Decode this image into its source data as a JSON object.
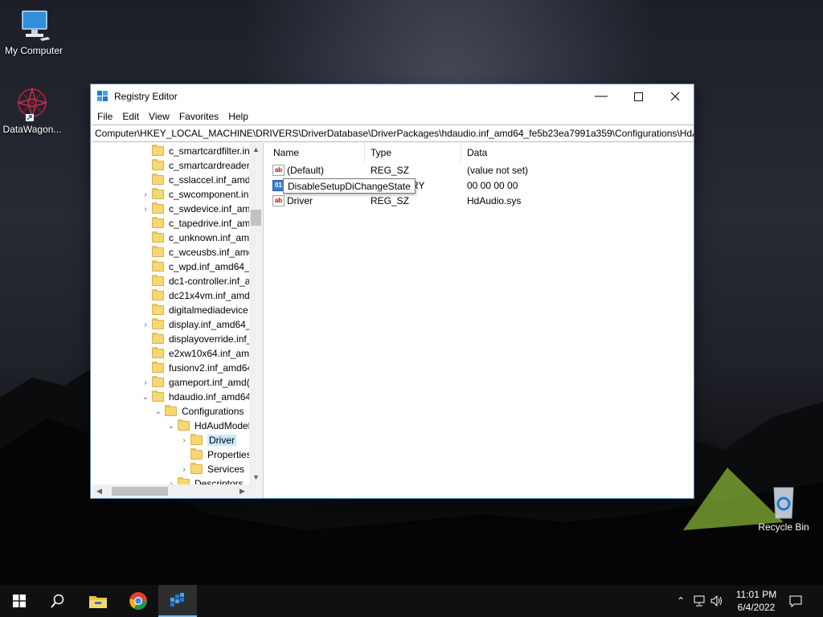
{
  "desktop": {
    "icons": [
      {
        "label": "My Computer",
        "icon": "computer-icon"
      },
      {
        "label": "DataWagon...",
        "icon": "datawagon-icon"
      },
      {
        "label": "Recycle Bin",
        "icon": "recycle-bin-icon"
      }
    ]
  },
  "window": {
    "title": "Registry Editor",
    "menu": [
      "File",
      "Edit",
      "View",
      "Favorites",
      "Help"
    ],
    "address": "Computer\\HKEY_LOCAL_MACHINE\\DRIVERS\\DriverDatabase\\DriverPackages\\hdaudio.inf_amd64_fe5b23ea7991a359\\Configurations\\HdAudModel\\Driver"
  },
  "tree": {
    "items": [
      {
        "label": "c_smartcardfilter.in",
        "expander": ""
      },
      {
        "label": "c_smartcardreader.",
        "expander": ""
      },
      {
        "label": "c_sslaccel.inf_amd6",
        "expander": ""
      },
      {
        "label": "c_swcomponent.in",
        "expander": "›"
      },
      {
        "label": "c_swdevice.inf_amd",
        "expander": "›"
      },
      {
        "label": "c_tapedrive.inf_am",
        "expander": ""
      },
      {
        "label": "c_unknown.inf_am",
        "expander": ""
      },
      {
        "label": "c_wceusbs.inf_amd",
        "expander": ""
      },
      {
        "label": "c_wpd.inf_amd64_(",
        "expander": ""
      },
      {
        "label": "dc1-controller.inf_a",
        "expander": ""
      },
      {
        "label": "dc21x4vm.inf_amd",
        "expander": ""
      },
      {
        "label": "digitalmediadevice",
        "expander": ""
      },
      {
        "label": "display.inf_amd64_",
        "expander": "›"
      },
      {
        "label": "displayoverride.inf_",
        "expander": ""
      },
      {
        "label": "e2xw10x64.inf_amc",
        "expander": ""
      },
      {
        "label": "fusionv2.inf_amd64",
        "expander": ""
      },
      {
        "label": "gameport.inf_amd(",
        "expander": "›"
      },
      {
        "label": "hdaudio.inf_amd64",
        "expander": "⌄"
      },
      {
        "label": "Configurations",
        "expander": "⌄"
      },
      {
        "label": "HdAudModel",
        "expander": "⌄"
      },
      {
        "label": "Driver",
        "expander": "›"
      },
      {
        "label": "Properties",
        "expander": ""
      },
      {
        "label": "Services",
        "expander": "›"
      },
      {
        "label": "Descriptors",
        "expander": "›"
      }
    ]
  },
  "list": {
    "headers": {
      "name": "Name",
      "type": "Type",
      "data": "Data"
    },
    "rows": [
      {
        "name": "(Default)",
        "type": "REG_SZ",
        "data": "(value not set)",
        "icon": "ab"
      },
      {
        "name": "DisableSetupDiChangeState",
        "type": "REG_BINARY",
        "data": "00 00 00 00",
        "icon": "01"
      },
      {
        "name": "Driver",
        "type": "REG_SZ",
        "data": "HdAudio.sys",
        "icon": "ab"
      }
    ],
    "tooltip": "DisableSetupDiChangeState",
    "covered_type_fragment": "ARY"
  },
  "taskbar": {
    "time": "11:01 PM",
    "date": "6/4/2022"
  },
  "colors": {
    "window_border": "#5b88b8",
    "selection": "#cce8ff",
    "taskbar": "#101010",
    "accent": "#76b9ed"
  }
}
